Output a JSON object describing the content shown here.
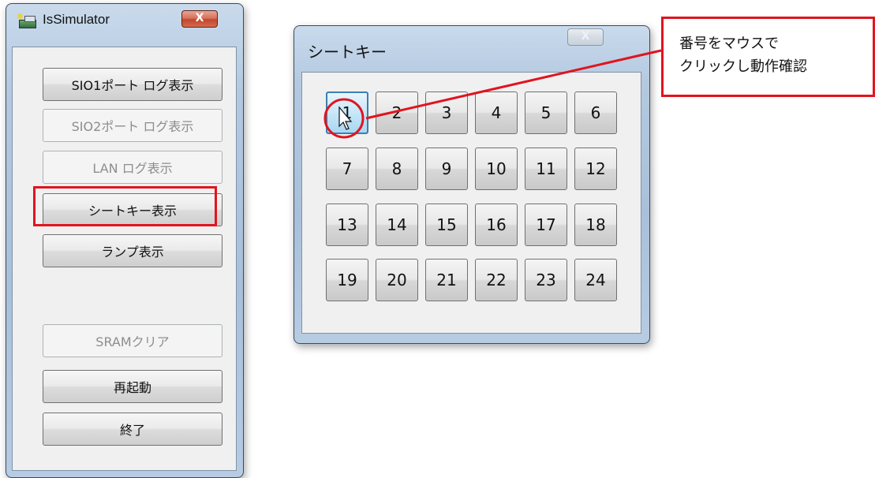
{
  "main_window": {
    "title": "IsSimulator",
    "close_label": "X",
    "buttons": [
      {
        "label": "SIO1ポート ログ表示",
        "enabled": true
      },
      {
        "label": "SIO2ポート ログ表示",
        "enabled": false
      },
      {
        "label": "LAN ログ表示",
        "enabled": false
      },
      {
        "label": "シートキー表示",
        "enabled": true,
        "highlighted": true
      },
      {
        "label": "ランプ表示",
        "enabled": true
      },
      {
        "label": "SRAMクリア",
        "enabled": false
      },
      {
        "label": "再起動",
        "enabled": true
      },
      {
        "label": "終了",
        "enabled": true
      }
    ]
  },
  "seat_window": {
    "title": "シートキー",
    "close_label": "X",
    "keys": [
      "1",
      "2",
      "3",
      "4",
      "5",
      "6",
      "7",
      "8",
      "9",
      "10",
      "11",
      "12",
      "13",
      "14",
      "15",
      "16",
      "17",
      "18",
      "19",
      "20",
      "21",
      "22",
      "23",
      "24"
    ],
    "focused_key": "1"
  },
  "annotation": {
    "line1": "番号をマウスで",
    "line2": "クリックし動作確認",
    "color": "#e0141e"
  }
}
